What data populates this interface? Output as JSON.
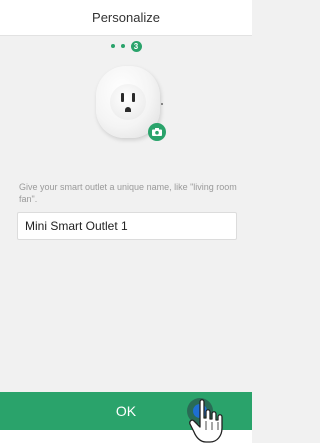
{
  "header": {
    "title": "Personalize"
  },
  "steps": {
    "current": "3",
    "total": 3
  },
  "prompt": {
    "text": "Give your smart outlet a unique name, like \"living room fan\"."
  },
  "name_field": {
    "value": "Mini Smart Outlet 1"
  },
  "actions": {
    "ok_label": "OK"
  },
  "icons": {
    "device": "smart-outlet-icon",
    "camera": "camera-icon",
    "cursor": "hand-pointer-icon"
  },
  "colors": {
    "accent": "#2aa36b",
    "background": "#f1f1f1",
    "header": "#ffffff"
  }
}
